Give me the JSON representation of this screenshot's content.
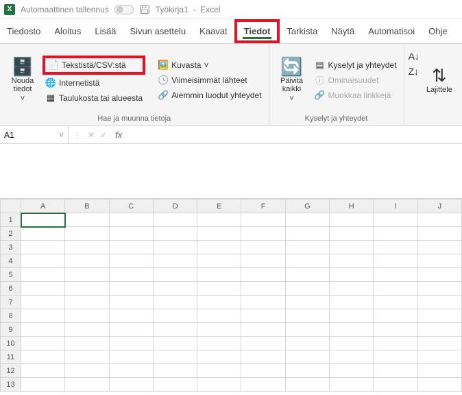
{
  "titlebar": {
    "autosave_label": "Automaattinen tallennus",
    "doc_title": "Työkirja1",
    "app_name": "Excel"
  },
  "tabs": {
    "tiedosto": "Tiedosto",
    "aloitus": "Aloitus",
    "lisaa": "Lisää",
    "sivun_asettelu": "Sivun asettelu",
    "kaavat": "Kaavat",
    "tiedot": "Tiedot",
    "tarkista": "Tarkista",
    "nayta": "Näytä",
    "automatisoi": "Automatisoi",
    "ohje": "Ohje"
  },
  "ribbon": {
    "nouda_tiedot": "Nouda tiedot",
    "tekstista_csv": "Tekstistä/CSV:stä",
    "internetista": "Internetistä",
    "taulukosta": "Taulukosta tai alueesta",
    "kuvasta": "Kuvasta",
    "viimeisimmat": "Viimeisimmät lähteet",
    "aiemmin": "Aiemmin luodut yhteydet",
    "group1_label": "Hae ja muunna tietoja",
    "paivita_kaikki": "Päivitä kaikki",
    "kyselyt_yhteydet": "Kyselyt ja yhteydet",
    "ominaisuudet": "Ominaisuudet",
    "muokkaa_linkkeja": "Muokkaa linkkejä",
    "group2_label": "Kyselyt ja yhteydet",
    "lajittele": "Lajittele"
  },
  "formula": {
    "cell_ref": "A1"
  },
  "columns": [
    "A",
    "B",
    "C",
    "D",
    "E",
    "F",
    "G",
    "H",
    "I",
    "J"
  ],
  "rows": [
    "1",
    "2",
    "3",
    "4",
    "5",
    "6",
    "7",
    "8",
    "9",
    "10",
    "11",
    "12",
    "13"
  ]
}
